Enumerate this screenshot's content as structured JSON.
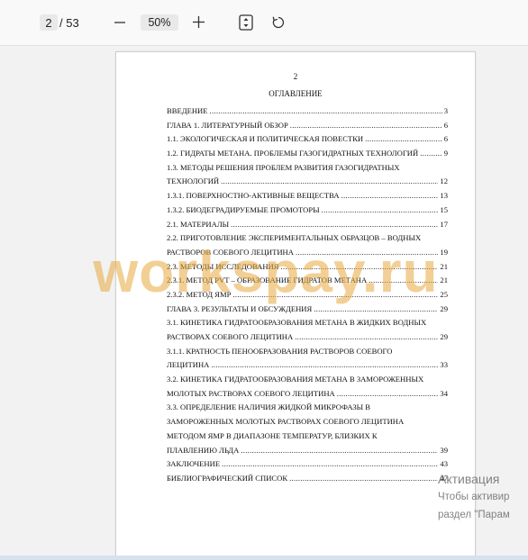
{
  "toolbar": {
    "page_current": "2",
    "page_total": "/ 53",
    "zoom": "50%",
    "minus_glyph": "—",
    "plus_glyph": "+",
    "fit_icon": "fit-page-icon",
    "rotate_icon": "rotate-icon"
  },
  "document": {
    "page_number": "2",
    "title": "ОГЛАВЛЕНИЕ",
    "toc": [
      {
        "text": "ВВЕДЕНИЕ",
        "page": "3"
      },
      {
        "text": "ГЛАВА 1. ЛИТЕРАТУРНЫЙ ОБЗОР",
        "page": "6"
      },
      {
        "text": "1.1. ЭКОЛОГИЧЕСКАЯ И ПОЛИТИЧЕСКАЯ ПОВЕСТКИ",
        "page": "6"
      },
      {
        "text": "1.2. ГИДРАТЫ МЕТАНА. ПРОБЛЕМЫ ГАЗОГИДРАТНЫХ ТЕХНОЛОГИЙ",
        "page": "9"
      },
      {
        "text": "1.3. МЕТОДЫ РЕШЕНИЯ ПРОБЛЕМ РАЗВИТИЯ ГАЗОГИДРАТНЫХ",
        "page": ""
      },
      {
        "text": "ТЕХНОЛОГИЙ",
        "page": "12"
      },
      {
        "text": "1.3.1. ПОВЕРХНОСТНО-АКТИВНЫЕ ВЕЩЕСТВА",
        "page": "13"
      },
      {
        "text": "1.3.2. БИОДЕГРАДИРУЕМЫЕ ПРОМОТОРЫ",
        "page": "15"
      },
      {
        "text": "2.1. МАТЕРИАЛЫ",
        "page": "17"
      },
      {
        "text": "2.2. ПРИГОТОВЛЕНИЕ ЭКСПЕРИМЕНТАЛЬНЫХ ОБРАЗЦОВ – ВОДНЫХ",
        "page": ""
      },
      {
        "text": "РАСТВОРОВ СОЕВОГО ЛЕЦИТИНА",
        "page": "19"
      },
      {
        "text": "2.3. МЕТОДЫ ИССЛЕДОВАНИЯ",
        "page": "21"
      },
      {
        "text": "2.3.1. МЕТОД PVT – ОБРАЗОВАНИЕ ГИДРАТОВ МЕТАНА",
        "page": "21"
      },
      {
        "text": "2.3.2. МЕТОД ЯМР",
        "page": "25"
      },
      {
        "text": "ГЛАВА 3. РЕЗУЛЬТАТЫ И ОБСУЖДЕНИЯ",
        "page": "29"
      },
      {
        "text": "3.1. КИНЕТИКА ГИДРАТООБРАЗОВАНИЯ МЕТАНА В ЖИДКИХ ВОДНЫХ",
        "page": ""
      },
      {
        "text": "РАСТВОРАХ СОЕВОГО ЛЕЦИТИНА",
        "page": "29"
      },
      {
        "text": "3.1.1. КРАТНОСТЬ ПЕНООБРАЗОВАНИЯ РАСТВОРОВ СОЕВОГО",
        "page": ""
      },
      {
        "text": "ЛЕЦИТИНА",
        "page": "33"
      },
      {
        "text": "3.2. КИНЕТИКА ГИДРАТООБРАЗОВАНИЯ МЕТАНА В ЗАМОРОЖЕННЫХ",
        "page": ""
      },
      {
        "text": "МОЛОТЫХ РАСТВОРАХ СОЕВОГО ЛЕЦИТИНА",
        "page": "34"
      },
      {
        "text": "3.3. ОПРЕДЕЛЕНИЕ НАЛИЧИЯ ЖИДКОЙ МИКРОФАЗЫ В",
        "page": ""
      },
      {
        "text": "ЗАМОРОЖЕННЫХ МОЛОТЫХ РАСТВОРАХ СОЕВОГО ЛЕЦИТИНА",
        "page": ""
      },
      {
        "text": "МЕТОДОМ ЯМР В ДИАПАЗОНЕ ТЕМПЕРАТУР, БЛИЗКИХ К",
        "page": ""
      },
      {
        "text": "ПЛАВЛЕНИЮ ЛЬДА",
        "page": "39"
      },
      {
        "text": "ЗАКЛЮЧЕНИЕ",
        "page": "43"
      },
      {
        "text": "БИБЛИОГРАФИЧЕСКИЙ СПИСОК",
        "page": "47"
      }
    ]
  },
  "watermark": "workspay.ru",
  "activation": {
    "title": "Активация",
    "line1": "Чтобы активир",
    "line2": "раздел \"Парам"
  },
  "colors": {
    "watermark": "#e8a83c",
    "toolbar_bg": "#f9f9f9",
    "viewer_bg": "#f2f2f2"
  }
}
